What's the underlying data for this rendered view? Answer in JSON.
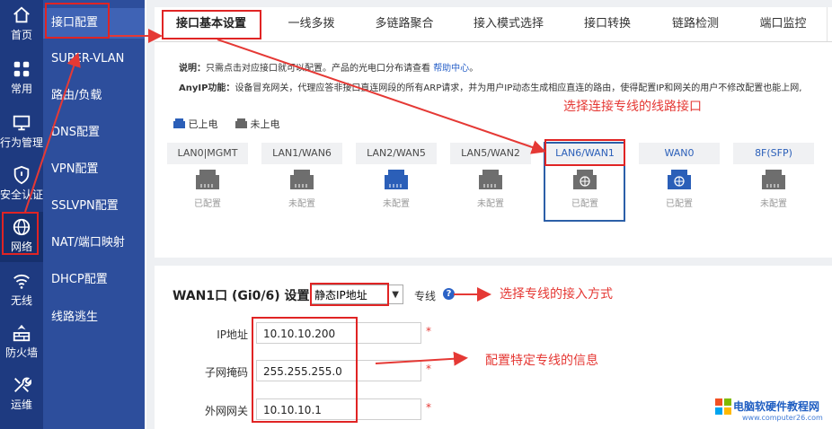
{
  "rail": {
    "items": [
      {
        "label": "首页",
        "icon": "home-icon"
      },
      {
        "label": "常用",
        "icon": "grid-icon"
      },
      {
        "label": "行为管理",
        "icon": "monitor-icon"
      },
      {
        "label": "安全认证",
        "icon": "shield-icon"
      },
      {
        "label": "网络",
        "icon": "globe-icon"
      },
      {
        "label": "无线",
        "icon": "wifi-icon"
      },
      {
        "label": "防火墙",
        "icon": "firewall-icon"
      },
      {
        "label": "运维",
        "icon": "tools-icon"
      }
    ]
  },
  "submenu": {
    "items": [
      "接口配置",
      "SUPER-VLAN",
      "路由/负载",
      "DNS配置",
      "VPN配置",
      "SSLVPN配置",
      "NAT/端口映射",
      "DHCP配置",
      "线路逃生"
    ]
  },
  "tabs": [
    "接口基本设置",
    "一线多拨",
    "多链路聚合",
    "接入模式选择",
    "接口转换",
    "链路检测",
    "端口监控"
  ],
  "notes": {
    "desc_label": "说明：",
    "desc_text": "只需点击对应接口就可以配置。产品的光电口分布请查看",
    "desc_link": "帮助中心",
    "desc_end": "。",
    "anyip_label": "AnyIP功能：",
    "anyip_text": "设备冒充网关，代理应答非接口直连网段的所有ARP请求，并为用户IP动态生成相应直连的路由，使得配置IP和网关的用户不修改配置也能上网,"
  },
  "legend": {
    "powered": "已上电",
    "unpowered": "未上电"
  },
  "ports": [
    {
      "name": "LAN0|MGMT",
      "status": "已配置",
      "powered": false
    },
    {
      "name": "LAN1/WAN6",
      "status": "未配置",
      "powered": false
    },
    {
      "name": "LAN2/WAN5",
      "status": "未配置",
      "powered": true
    },
    {
      "name": "LAN5/WAN2",
      "status": "未配置",
      "powered": false
    },
    {
      "name": "LAN6/WAN1",
      "status": "已配置",
      "powered": false
    },
    {
      "name": "WAN0",
      "status": "已配置",
      "powered": true
    },
    {
      "name": "8F(SFP)",
      "status": "未配置",
      "powered": false
    }
  ],
  "wan": {
    "title": "WAN1口 (Gi0/6) 设置",
    "mode": "静态IP地址",
    "mode_suffix": "专线",
    "help": "?",
    "fields": [
      {
        "label": "IP地址",
        "value": "10.10.10.200"
      },
      {
        "label": "子网掩码",
        "value": "255.255.255.0"
      },
      {
        "label": "外网网关",
        "value": "10.10.10.1"
      }
    ],
    "required_mark": "*"
  },
  "annotations": {
    "select_port": "选择连接专线的线路接口",
    "select_mode": "选择专线的接入方式",
    "configure": "配置特定专线的信息"
  },
  "watermark": {
    "brand": "电脑软硬件教程网",
    "url": "www.computer26.com"
  },
  "colors": {
    "rail": "#1e3a80",
    "submenu": "#2d4e9c",
    "accent": "#2c60b9",
    "annotation": "#e53935"
  }
}
